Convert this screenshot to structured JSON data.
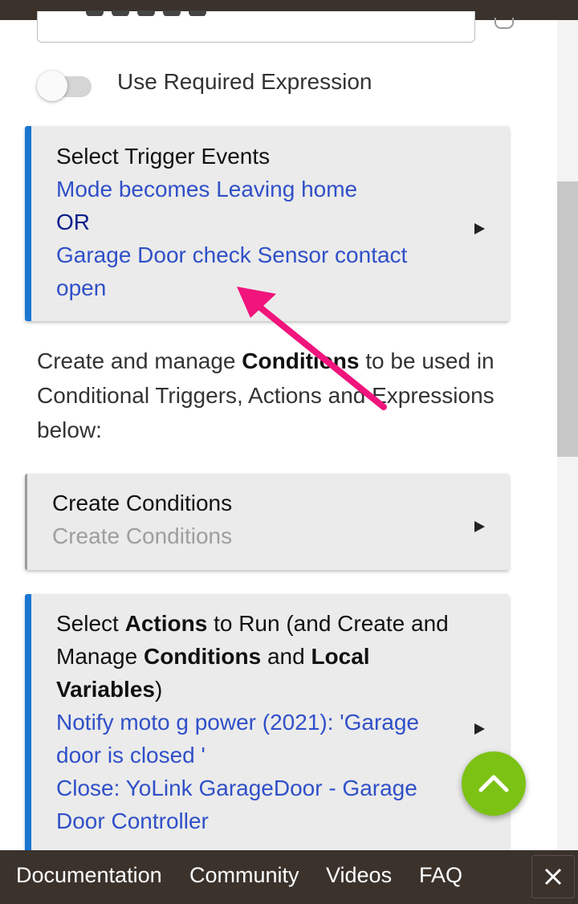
{
  "toggle": {
    "label": "Use Required Expression",
    "on": false
  },
  "trigger_card": {
    "title": "Select Trigger Events",
    "line1": "Mode becomes Leaving home",
    "line2": "OR",
    "line3": "Garage Door check Sensor  contact open"
  },
  "intro": {
    "text_before": "Create and manage ",
    "bold": "Conditions",
    "text_after": " to be used in Conditional Triggers, Actions and Expressions below:"
  },
  "conditions_card": {
    "title": "Create Conditions",
    "subtitle": "Create Conditions"
  },
  "actions_card": {
    "t1": "Select ",
    "b1": "Actions",
    "t2": " to Run (and Create and Manage ",
    "b2": "Conditions",
    "t3": " and ",
    "b3": "Local Variables",
    "t4": ")",
    "action1": "Notify moto g power (2021): 'Garage door is closed '",
    "action2": "Close: YoLink GarageDoor - Garage Door Controller"
  },
  "footer": {
    "documentation": "Documentation",
    "community": "Community",
    "videos": "Videos",
    "faq": "FAQ"
  },
  "icons": {
    "fab": "chevron-up-icon",
    "close": "close-icon",
    "card_arrow": "triangle-right-icon"
  },
  "colors": {
    "accent_blue": "#1976d2",
    "link_blue": "#3050c8",
    "fab_green": "#7cc214",
    "annotation_pink": "#f0147c",
    "footer_bg": "#3b322c"
  }
}
